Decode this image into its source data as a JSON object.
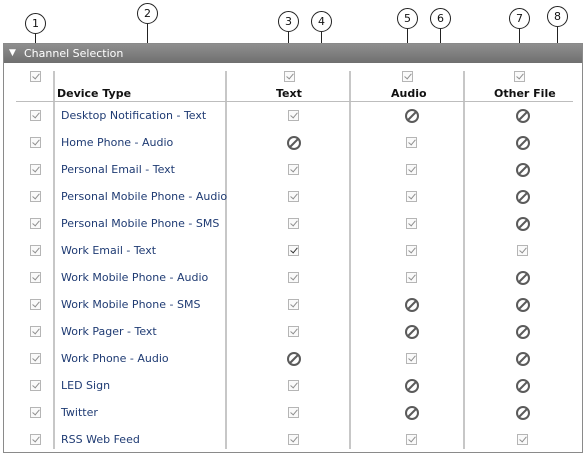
{
  "callouts": [
    "1",
    "2",
    "3",
    "4",
    "5",
    "6",
    "7",
    "8"
  ],
  "panel": {
    "title": "Channel Selection",
    "collapse_icon": "triangle-down-icon"
  },
  "columns": {
    "device": "Device Type",
    "text": "Text",
    "audio": "Audio",
    "other": "Other File"
  },
  "rows": [
    {
      "name": "Desktop Notification - Text",
      "text": "check",
      "audio": "na",
      "other": "na"
    },
    {
      "name": "Home Phone - Audio",
      "text": "na",
      "audio": "check",
      "other": "na"
    },
    {
      "name": "Personal Email - Text",
      "text": "check",
      "audio": "check",
      "other": "na"
    },
    {
      "name": "Personal Mobile Phone - Audio",
      "text": "check",
      "audio": "check",
      "other": "na"
    },
    {
      "name": "Personal Mobile Phone - SMS",
      "text": "check",
      "audio": "check",
      "other": "na"
    },
    {
      "name": "Work Email - Text",
      "text": "check",
      "audio": "check",
      "other": "check"
    },
    {
      "name": "Work Mobile Phone - Audio",
      "text": "check",
      "audio": "check",
      "other": "na"
    },
    {
      "name": "Work Mobile Phone - SMS",
      "text": "check",
      "audio": "na",
      "other": "na"
    },
    {
      "name": "Work Pager - Text",
      "text": "check",
      "audio": "na",
      "other": "na"
    },
    {
      "name": "Work Phone - Audio",
      "text": "na",
      "audio": "check",
      "other": "na"
    },
    {
      "name": "LED Sign",
      "text": "check",
      "audio": "na",
      "other": "na"
    },
    {
      "name": "Twitter",
      "text": "check",
      "audio": "na",
      "other": "na"
    },
    {
      "name": "RSS Web Feed",
      "text": "check",
      "audio": "check",
      "other": "check"
    }
  ]
}
